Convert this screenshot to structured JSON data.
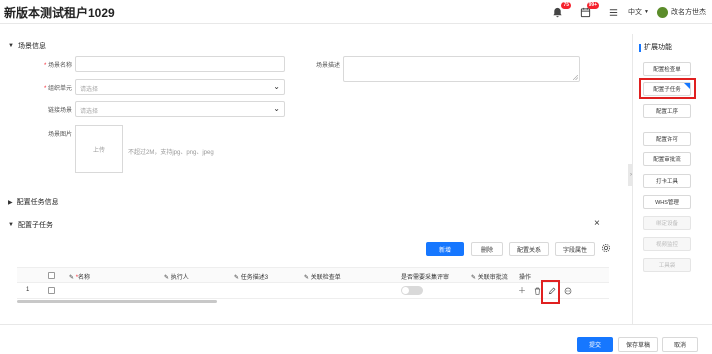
{
  "header": {
    "title": "新版本测试租户1029",
    "notify_badge": "75",
    "msg_badge": "99+",
    "language": "中文",
    "user_name": "改名方世杰"
  },
  "scene_section": {
    "title": "场景信息",
    "fields": {
      "name_label": "场景名称",
      "org_label": "组织单元",
      "org_placeholder": "请选择",
      "link_label": "链接场景",
      "link_placeholder": "请选择",
      "image_label": "场景图片",
      "upload_label": "上传",
      "upload_hint": "不超过2M，支持jpg、png、jpeg",
      "desc_label": "场景描述"
    }
  },
  "task_info_section": {
    "title": "配置任务信息"
  },
  "subtask_section": {
    "title": "配置子任务",
    "close": "×",
    "buttons": {
      "add": "新增",
      "delete": "删除",
      "relation": "配置关系",
      "fields": "字段属性"
    },
    "columns": [
      "名称",
      "执行人",
      "任务描述3",
      "关联检查单",
      "是否需要采集评审",
      "关联审批流",
      "操作"
    ],
    "rows": [
      {
        "index": "1",
        "collect_review": false
      }
    ]
  },
  "sidebar": {
    "title": "扩展功能",
    "items": [
      {
        "label": "配置检查单",
        "disabled": false
      },
      {
        "label": "配置子任务",
        "disabled": false
      },
      {
        "label": "配置工序",
        "disabled": false
      },
      {
        "label": "配置许可",
        "disabled": false
      },
      {
        "label": "配置审批流",
        "disabled": false
      },
      {
        "label": "打卡工具",
        "disabled": false
      },
      {
        "label": "WHS管理",
        "disabled": false
      },
      {
        "label": "绑定设备",
        "disabled": true
      },
      {
        "label": "视频监控",
        "disabled": true
      },
      {
        "label": "工具袋",
        "disabled": true
      }
    ]
  },
  "footer": {
    "submit": "提交",
    "save_draft": "保存草稿",
    "cancel": "取消"
  },
  "colors": {
    "primary": "#1677ff",
    "danger": "#f5222d",
    "highlight": "#e02020"
  }
}
